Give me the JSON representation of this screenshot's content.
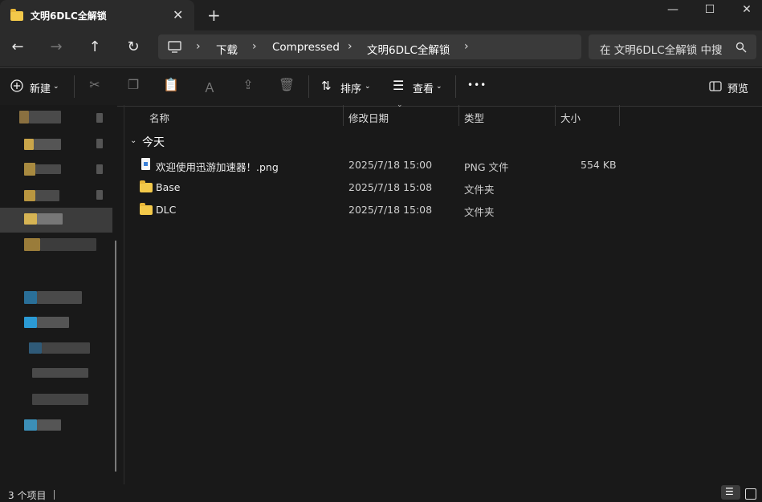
{
  "window": {
    "tab_title": "文明6DLC全解锁",
    "close_tab": "✕",
    "new_tab": "+",
    "minimize": "—",
    "maximize": "☐",
    "close": "✕"
  },
  "nav": {
    "back": "←",
    "forward": "→",
    "up": "↑",
    "refresh": "↻",
    "breadcrumb": [
      "下载",
      "Compressed",
      "文明6DLC全解锁"
    ],
    "search_placeholder": "在 文明6DLC全解锁 中搜"
  },
  "toolbar": {
    "new_label": "新建",
    "sort_label": "排序",
    "view_label": "查看",
    "more_label": "•••",
    "preview_label": "预览"
  },
  "columns": [
    "名称",
    "修改日期",
    "类型",
    "大小"
  ],
  "group_label": "今天",
  "files": [
    {
      "name": "欢迎使用迅游加速器！.png",
      "modified": "2025/7/18 15:00",
      "type": "PNG 文件",
      "size": "554 KB",
      "icon": "png-file-icon"
    },
    {
      "name": "Base",
      "modified": "2025/7/18 15:08",
      "type": "文件夹",
      "size": "",
      "icon": "folder-icon"
    },
    {
      "name": "DLC",
      "modified": "2025/7/18 15:08",
      "type": "文件夹",
      "size": "",
      "icon": "folder-icon"
    }
  ],
  "status": {
    "item_count": "3 个项目"
  },
  "colors": {
    "accent_folder": "#f3c94a",
    "background": "#191919",
    "selected": "#3c3c3c"
  }
}
